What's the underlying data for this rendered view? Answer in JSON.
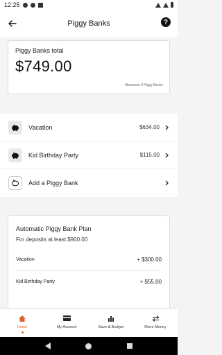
{
  "status_bar": {
    "time": "12:25"
  },
  "header": {
    "title": "Piggy Banks",
    "back_icon": "arrow-left-icon",
    "help_icon": "help-circle-icon",
    "help_glyph": "?"
  },
  "total": {
    "label": "Piggy Banks total",
    "amount": "$749.00",
    "max_note": "Maximum 3 Piggy Banks"
  },
  "banks": [
    {
      "name": "Vacation",
      "amount": "$634.00",
      "icon": "piggy-bank-icon"
    },
    {
      "name": "Kid Birthday Party",
      "amount": "$115.00",
      "icon": "piggy-bank-icon"
    },
    {
      "name": "Add a Piggy Bank",
      "amount": "",
      "icon": "piggy-bank-outline-icon"
    }
  ],
  "plan": {
    "title": "Automatic Piggy Bank Plan",
    "subtitle": "For deposits at least $900.00",
    "rows": [
      {
        "name": "Vacation",
        "amount": "+ $300.00"
      },
      {
        "name": "Kid Birthday Party",
        "amount": "+ $55.00"
      }
    ],
    "button_color": "#3a7bbf"
  },
  "nav": {
    "items": [
      {
        "label": "Home",
        "icon": "home-icon",
        "active": true
      },
      {
        "label": "My Account",
        "icon": "card-icon",
        "active": false
      },
      {
        "label": "Save & Budget",
        "icon": "bar-chart-icon",
        "active": false
      },
      {
        "label": "Move Money",
        "icon": "transfer-icon",
        "active": false
      }
    ],
    "active_color": "#d8662b"
  }
}
